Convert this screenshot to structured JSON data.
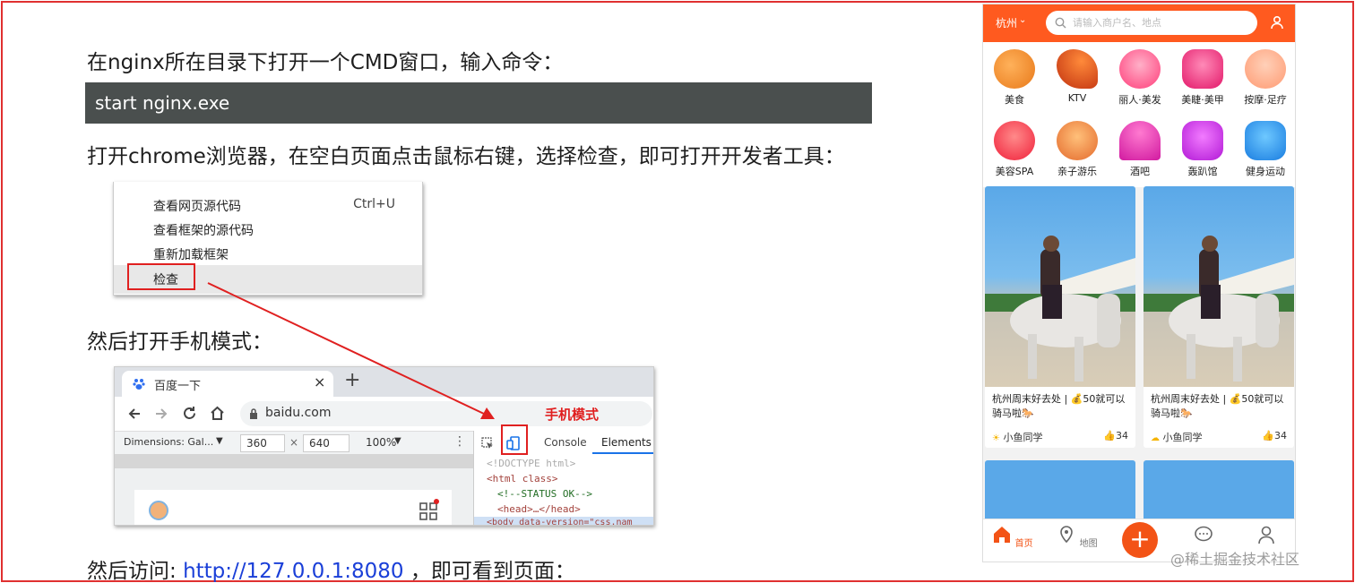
{
  "doc": {
    "step1": "在nginx所在目录下打开一个CMD窗口，输入命令：",
    "command": "start nginx.exe",
    "step2": "打开chrome浏览器，在空白页面点击鼠标右键，选择检查，即可打开开发者工具：",
    "step3": "然后打开手机模式：",
    "step4_prefix": "然后访问: ",
    "step4_link": "http://127.0.0.1:8080",
    "step4_suffix": " ，即可看到页面："
  },
  "context_menu": {
    "items": [
      "查看网页源代码",
      "查看框架的源代码",
      "重新加载框架",
      "检查"
    ],
    "shortcut": "Ctrl+U"
  },
  "browser": {
    "tab_title": "百度一下",
    "tab_close": "×",
    "new_tab": "+",
    "url": "baidu.com",
    "dimensions_label": "Dimensions: Gal...",
    "width": "360",
    "times": "×",
    "height": "640",
    "zoom": "100%",
    "devtools_tabs": [
      "Console",
      "Elements"
    ],
    "code_lines": [
      "<!DOCTYPE html>",
      "<html class>",
      "<!--STATUS OK-->",
      "<head>…</head>",
      "<body data-version=\"css.nam"
    ],
    "mobile_mode_label": "手机模式"
  },
  "phone": {
    "city": "杭州",
    "search_placeholder": "请输入商户名、地点",
    "categories": [
      "美食",
      "KTV",
      "丽人·美发",
      "美睫·美甲",
      "按摩·足疗",
      "美容SPA",
      "亲子游乐",
      "酒吧",
      "轰趴馆",
      "健身运动"
    ],
    "cards": [
      {
        "title": "杭州周末好去处 | 💰50就可以骑马啦🐎",
        "user": "小鱼同学",
        "likes": "34"
      },
      {
        "title": "杭州周末好去处 | 💰50就可以骑马啦🐎",
        "user": "小鱼同学",
        "likes": "34"
      }
    ],
    "tabbar": [
      "首页",
      "地图",
      "",
      "",
      ""
    ]
  },
  "watermark": "@稀土掘金技术社区",
  "colors": {
    "brand": "#ff5a1f",
    "highlight": "#e02020",
    "link": "#1a3fd8",
    "code_bg": "#4a4f4e"
  }
}
